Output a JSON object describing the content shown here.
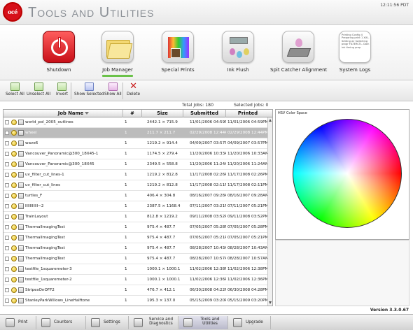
{
  "header": {
    "logo_text": "océ",
    "title": "Tools and Utilities",
    "clock": "12:11:56 PDT"
  },
  "tools": [
    {
      "label": "Shutdown",
      "icon": "power-icon"
    },
    {
      "label": "Job Manager",
      "icon": "folder-icon",
      "selected": true
    },
    {
      "label": "Special Prints",
      "icon": "special-prints-icon"
    },
    {
      "label": "Ink Flush",
      "icon": "ink-flush-icon"
    },
    {
      "label": "Spit Catcher Alignment",
      "icon": "spit-catcher-icon"
    },
    {
      "label": "System Logs",
      "icon": "system-logs-icon"
    }
  ],
  "system_logs_preview": "Printing Config 4 Preparing print 1 XXL. Setting wr Switching progr FILTERCTL. Doin ink timing prep",
  "toolbar": {
    "select_all": "Select All",
    "unselect_all": "Unselect All",
    "invert": "Invert",
    "show_selected": "Show Selected",
    "show_all": "Show All",
    "delete": "Delete"
  },
  "summary": {
    "total_jobs": "Total Jobs: 180",
    "selected_jobs": "Selected jobs: 0"
  },
  "table": {
    "columns": {
      "name": "Job Name",
      "job": "#",
      "size": "Size",
      "submitted": "Submitted",
      "printed": "Printed"
    },
    "rows": [
      {
        "name": "world_pol_2005_outlines",
        "job": "1",
        "size": "2442.1 × 715.9",
        "submitted": "11/01/2006 04:59PM",
        "printed": "11/01/2006 04:59PM"
      },
      {
        "name": "wheel",
        "job": "1",
        "size": "211.7 × 211.7",
        "submitted": "02/29/2008 12:44PM",
        "printed": "02/29/2008 12:44PM",
        "selected": true
      },
      {
        "name": "wave6",
        "job": "1",
        "size": "1219.2 × 914.4",
        "submitted": "04/09/2007 03:57PM",
        "printed": "04/09/2007 03:57PM"
      },
      {
        "name": "Vancouver_Panoramic@300_18X45-1",
        "job": "1",
        "size": "1174.5 × 279.4",
        "submitted": "11/20/2006 10:33AM",
        "printed": "11/20/2006 10:33AM"
      },
      {
        "name": "Vancouver_Panoramic@300_18X45",
        "job": "1",
        "size": "2349.5 × 558.8",
        "submitted": "11/20/2006 11:24AM",
        "printed": "11/20/2006 11:24AM"
      },
      {
        "name": "uv_filter_cut_lines-1",
        "job": "1",
        "size": "1219.2 × 812.8",
        "submitted": "11/17/2008 02:26PM",
        "printed": "11/17/2008 02:26PM"
      },
      {
        "name": "uv_filter_cut_lines",
        "job": "1",
        "size": "1219.2 × 812.8",
        "submitted": "11/17/2008 02:11PM",
        "printed": "11/17/2008 02:11PM"
      },
      {
        "name": "turtles_F",
        "job": "1",
        "size": "406.4 × 304.8",
        "submitted": "08/16/2007 09:28AM",
        "printed": "08/16/2007 09:28AM"
      },
      {
        "name": "IIIIIIIIIII~2",
        "job": "1",
        "size": "2387.5 × 1168.4",
        "submitted": "07/11/2007 03:21PM",
        "printed": "07/11/2007 05:21PM"
      },
      {
        "name": "TrainLayout",
        "job": "1",
        "size": "812.8 × 1219.2",
        "submitted": "09/11/2008 03:52PM",
        "printed": "09/11/2008 03:52PM"
      },
      {
        "name": "ThermalImagingTest",
        "job": "1",
        "size": "975.4 × 487.7",
        "submitted": "07/05/2007 05:28PM",
        "printed": "07/05/2007 05:28PM"
      },
      {
        "name": "ThermalImagingTest",
        "job": "1",
        "size": "975.4 × 487.7",
        "submitted": "07/05/2007 05:21PM",
        "printed": "07/05/2007 05:21PM"
      },
      {
        "name": "ThermalImagingTest",
        "job": "1",
        "size": "975.4 × 487.7",
        "submitted": "08/28/2007 10:43AM",
        "printed": "08/28/2007 10:43AM"
      },
      {
        "name": "ThermalImagingTest",
        "job": "1",
        "size": "975.4 × 487.7",
        "submitted": "08/28/2007 10:57AM",
        "printed": "08/28/2007 10:57AM"
      },
      {
        "name": "testfile_1squaremeter-3",
        "job": "1",
        "size": "1000.1 × 1000.1",
        "submitted": "11/02/2006 12:38PM",
        "printed": "11/02/2006 12:38PM"
      },
      {
        "name": "testfile_1squaremeter-2",
        "job": "1",
        "size": "1000.1 × 1000.1",
        "submitted": "11/02/2006 12:36PM",
        "printed": "11/02/2006 12:36PM"
      },
      {
        "name": "StripesOnOFF2",
        "job": "1",
        "size": "476.7 × 412.1",
        "submitted": "06/30/2008 04:22PM",
        "printed": "06/30/2008 04:28PM"
      },
      {
        "name": "StanleyParkWillows_LineHalftone",
        "job": "1",
        "size": "195.3 × 137.0",
        "submitted": "05/15/2009 03:20PM",
        "printed": "05/15/2009 03:20PM"
      },
      {
        "name": "StanleyParkWillows_inverted_light_halftone_53",
        "job": "1",
        "size": "203.6 × 143.5",
        "submitted": "04/28/2009 04:29PM",
        "printed": "04/28/2009 04:29PM"
      }
    ]
  },
  "preview": {
    "title": "HSV Color Space"
  },
  "version": "Version 3.3.0.67",
  "bottom_nav": [
    {
      "label": "Print",
      "icon": "print-icon"
    },
    {
      "label": "Counters",
      "icon": "counters-icon"
    },
    {
      "label": "Settings",
      "icon": "settings-icon"
    },
    {
      "label": "Service and Diagnostics",
      "icon": "service-icon"
    },
    {
      "label": "Tools and Utilities",
      "icon": "tools-icon",
      "active": true
    },
    {
      "label": "Upgrade",
      "icon": "upgrade-icon"
    }
  ],
  "colors": {
    "brand_red": "#d6101a",
    "selected_row": "#bcbcbc",
    "active_indicator": "#6bc24a"
  }
}
